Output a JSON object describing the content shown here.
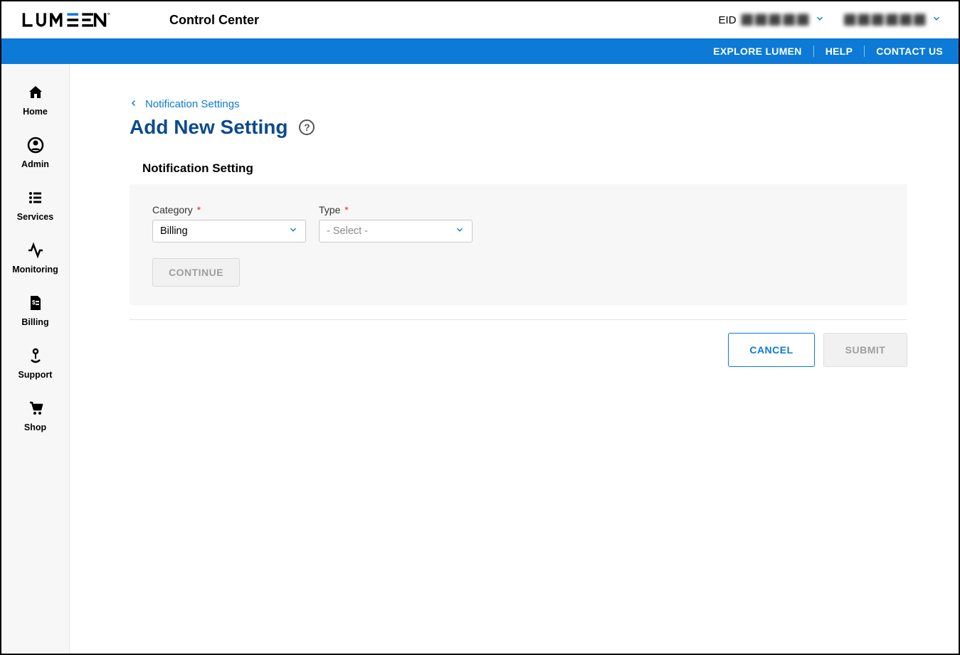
{
  "header": {
    "app_title": "Control Center",
    "eid_label": "EID",
    "eid_value": "⬛⬛⬛⬛⬛",
    "user_value": "⬛⬛⬛⬛⬛⬛"
  },
  "bluebar": {
    "explore": "EXPLORE LUMEN",
    "help": "HELP",
    "contact": "CONTACT US"
  },
  "sidebar": {
    "items": [
      {
        "name": "home",
        "label": "Home"
      },
      {
        "name": "admin",
        "label": "Admin"
      },
      {
        "name": "services",
        "label": "Services"
      },
      {
        "name": "monitoring",
        "label": "Monitoring"
      },
      {
        "name": "billing",
        "label": "Billing"
      },
      {
        "name": "support",
        "label": "Support"
      },
      {
        "name": "shop",
        "label": "Shop"
      }
    ]
  },
  "breadcrumb": {
    "label": "Notification Settings"
  },
  "page": {
    "title": "Add New Setting"
  },
  "form": {
    "section_title": "Notification Setting",
    "category_label": "Category",
    "category_value": "Billing",
    "type_label": "Type",
    "type_placeholder": "- Select -",
    "continue_label": "CONTINUE"
  },
  "actions": {
    "cancel": "CANCEL",
    "submit": "SUBMIT"
  }
}
